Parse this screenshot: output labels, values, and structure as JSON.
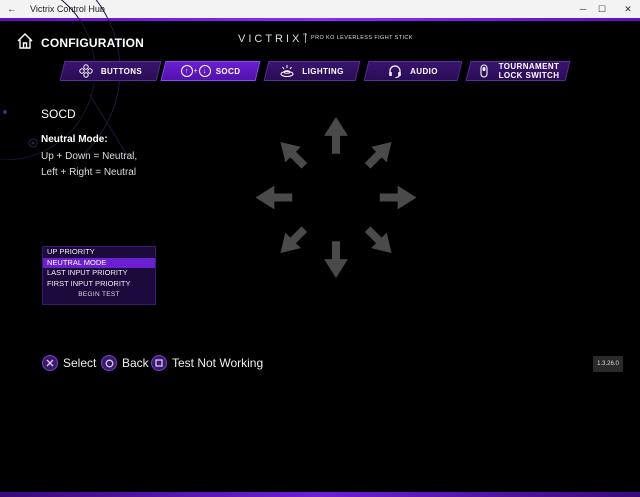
{
  "window": {
    "title": "Victrix Control Hub",
    "back_glyph": "←",
    "minimize_glyph": "─",
    "maximize_glyph": "☐",
    "close_glyph": "✕"
  },
  "header": {
    "page_title": "CONFIGURATION",
    "brand": "VICTRIX",
    "brand_mark": "™",
    "subbrand": "PRO KO LEVERLESS FIGHT STICK"
  },
  "tabs": [
    {
      "label": "BUTTONS",
      "icon": "buttons-icon",
      "active": false
    },
    {
      "label": "SOCD",
      "icon": "socd-icon",
      "active": true,
      "icon_text_a": "↑",
      "icon_text_plus": "+",
      "icon_text_b": "↓"
    },
    {
      "label": "LIGHTING",
      "icon": "lighting-icon",
      "active": false
    },
    {
      "label": "AUDIO",
      "icon": "headset-icon",
      "active": false
    },
    {
      "label": "TOURNAMENT\nLOCK SWITCH",
      "icon": "lock-switch-icon",
      "active": false
    }
  ],
  "section": {
    "title": "SOCD",
    "mode_label": "Neutral Mode:",
    "lines": [
      "Up + Down = Neutral,",
      "Left + Right = Neutral"
    ]
  },
  "menu": {
    "items": [
      "UP PRIORITY",
      "NEUTRAL MODE",
      "LAST INPUT PRIORITY",
      "FIRST INPUT PRIORITY"
    ],
    "selected_index": 1,
    "test_label": "BEGIN TEST"
  },
  "hints": [
    {
      "label": "Select",
      "glyph": "cross-icon"
    },
    {
      "label": "Back",
      "glyph": "circle-icon"
    },
    {
      "label": "Test Not Working",
      "glyph": "square-icon"
    }
  ],
  "version": "1.3.26.0",
  "colors": {
    "accent": "#6a1fd0",
    "tab_bg": "#2a0d55",
    "arrow": "#4a4a4a",
    "arrow_highlight": "#5a5a5a"
  }
}
